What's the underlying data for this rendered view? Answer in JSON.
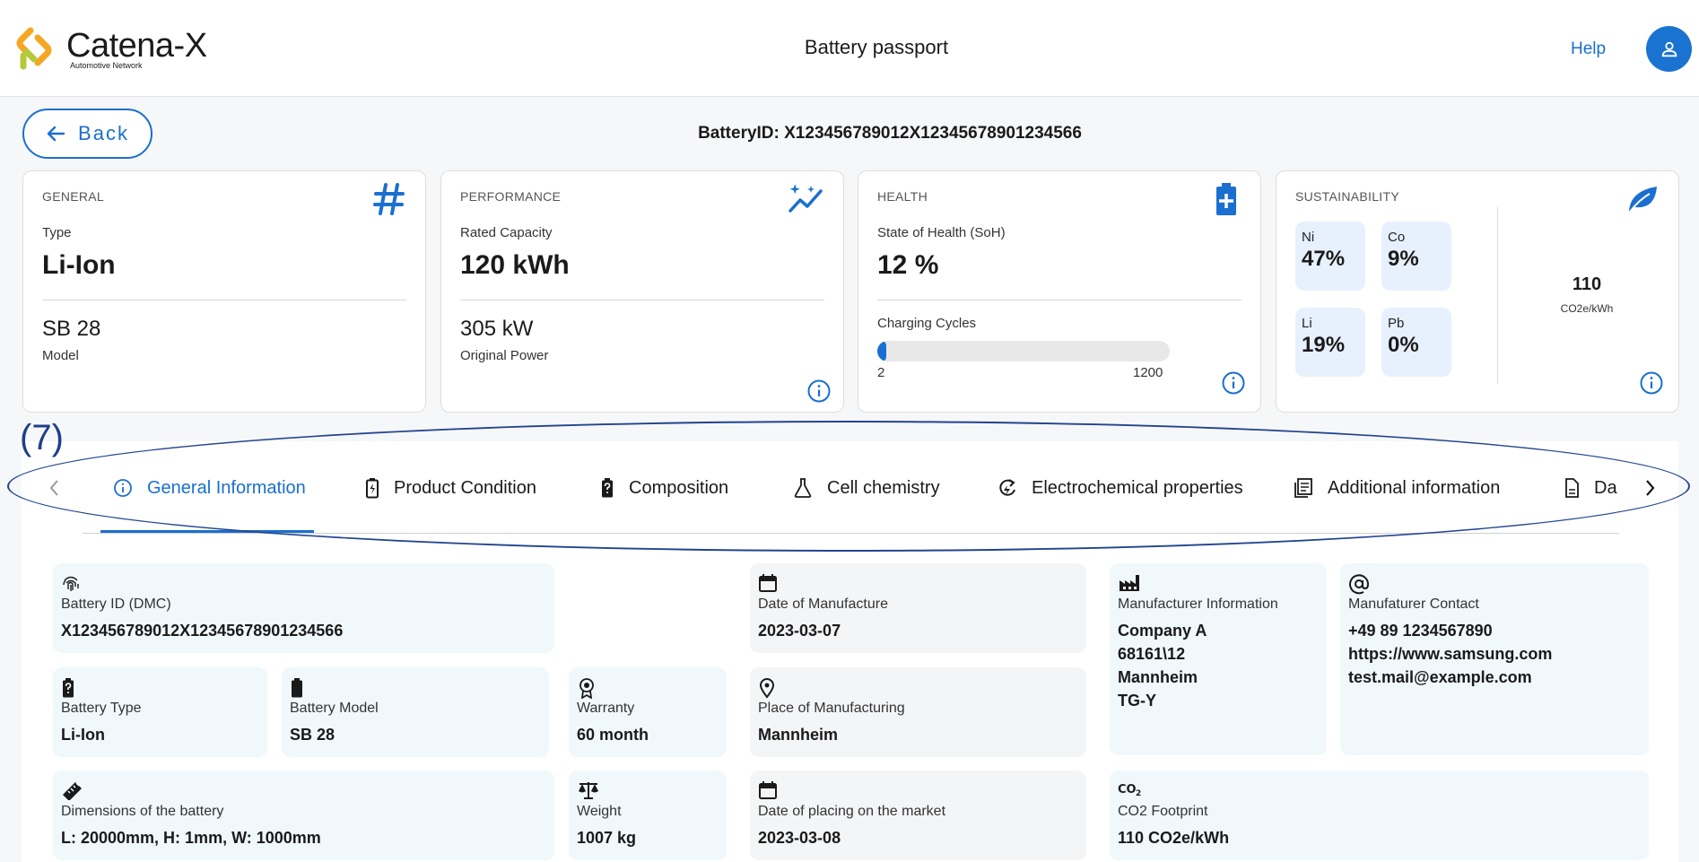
{
  "header": {
    "logo_title": "Catena-X",
    "logo_subtitle": "Automotive Network",
    "page_title": "Battery passport",
    "help_label": "Help",
    "avatar_icon": "user-icon"
  },
  "toolbar": {
    "back_label": "Back",
    "battery_id_heading": "BatteryID: X123456789012X12345678901234566"
  },
  "cards": {
    "general": {
      "category": "GENERAL",
      "icon": "hash-icon",
      "type_label": "Type",
      "type_value": "Li-Ion",
      "model_value": "SB 28",
      "model_label": "Model"
    },
    "performance": {
      "category": "PERFORMANCE",
      "icon": "performance-chart-icon",
      "capacity_label": "Rated Capacity",
      "capacity_value": "120 kWh",
      "power_value": "305 kW",
      "power_label": "Original Power"
    },
    "health": {
      "category": "HEALTH",
      "icon": "battery-plus-icon",
      "soh_label": "State of Health (SoH)",
      "soh_value": "12 %",
      "cycles_label": "Charging Cycles",
      "cycles_min": "2",
      "cycles_max": "1200",
      "cycles_progress_fraction": 0.02
    },
    "sustainability": {
      "category": "SUSTAINABILITY",
      "icon": "leaf-icon",
      "materials": [
        {
          "symbol": "Ni",
          "percent": "47%"
        },
        {
          "symbol": "Co",
          "percent": "9%"
        },
        {
          "symbol": "Li",
          "percent": "19%"
        },
        {
          "symbol": "Pb",
          "percent": "0%"
        }
      ],
      "co2_value": "110",
      "co2_unit": "CO2e/kWh"
    }
  },
  "annotation": {
    "label": "(7)"
  },
  "tabs": [
    {
      "label": "General Information",
      "icon": "info-icon",
      "active": true
    },
    {
      "label": "Product Condition",
      "icon": "battery-charging-icon",
      "active": false
    },
    {
      "label": "Composition",
      "icon": "battery-unknown-icon",
      "active": false
    },
    {
      "label": "Cell chemistry",
      "icon": "flask-icon",
      "active": false
    },
    {
      "label": "Electrochemical properties",
      "icon": "electrochemical-icon",
      "active": false
    },
    {
      "label": "Additional information",
      "icon": "document-list-icon",
      "active": false
    },
    {
      "label": "Da",
      "icon": "file-icon",
      "active": false
    }
  ],
  "info": {
    "battery_id": {
      "label": "Battery ID (DMC)",
      "value": "X123456789012X12345678901234566",
      "icon": "fingerprint-icon"
    },
    "battery_type": {
      "label": "Battery Type",
      "value": "Li-Ion",
      "icon": "battery-unknown-icon"
    },
    "battery_model": {
      "label": "Battery Model",
      "value": "SB 28",
      "icon": "battery-icon"
    },
    "warranty": {
      "label": "Warranty",
      "value": "60 month",
      "icon": "badge-icon"
    },
    "dimensions": {
      "label": "Dimensions of the battery",
      "value": "L: 20000mm, H: 1mm, W: 1000mm",
      "icon": "ruler-icon"
    },
    "weight": {
      "label": "Weight",
      "value": "1007 kg",
      "icon": "scale-icon"
    },
    "date_manufacture": {
      "label": "Date of Manufacture",
      "value": "2023-03-07",
      "icon": "calendar-icon"
    },
    "place_manufacturing": {
      "label": "Place of Manufacturing",
      "value": "Mannheim",
      "icon": "location-pin-icon"
    },
    "date_market": {
      "label": "Date of placing on the market",
      "value": "2023-03-08",
      "icon": "calendar-icon"
    },
    "manufacturer_info": {
      "label": "Manufacturer Information",
      "lines": [
        "Company A",
        "68161\\12",
        "Mannheim",
        "TG-Y"
      ],
      "icon": "factory-icon"
    },
    "manufacturer_contact": {
      "label": "Manufaturer Contact",
      "lines": [
        "+49 89 1234567890",
        "https://www.samsung.com",
        "test.mail@example.com"
      ],
      "icon": "at-icon"
    },
    "co2_footprint": {
      "label": "CO2 Footprint",
      "value": "110 CO2e/kWh",
      "icon": "co2-icon"
    }
  },
  "colors": {
    "accent": "#1a6fd0",
    "tile_blue": "#f0f8fc",
    "tile_grey": "#f4f5f7",
    "material_chip": "#e7f0fd",
    "annotation": "#22448f"
  }
}
